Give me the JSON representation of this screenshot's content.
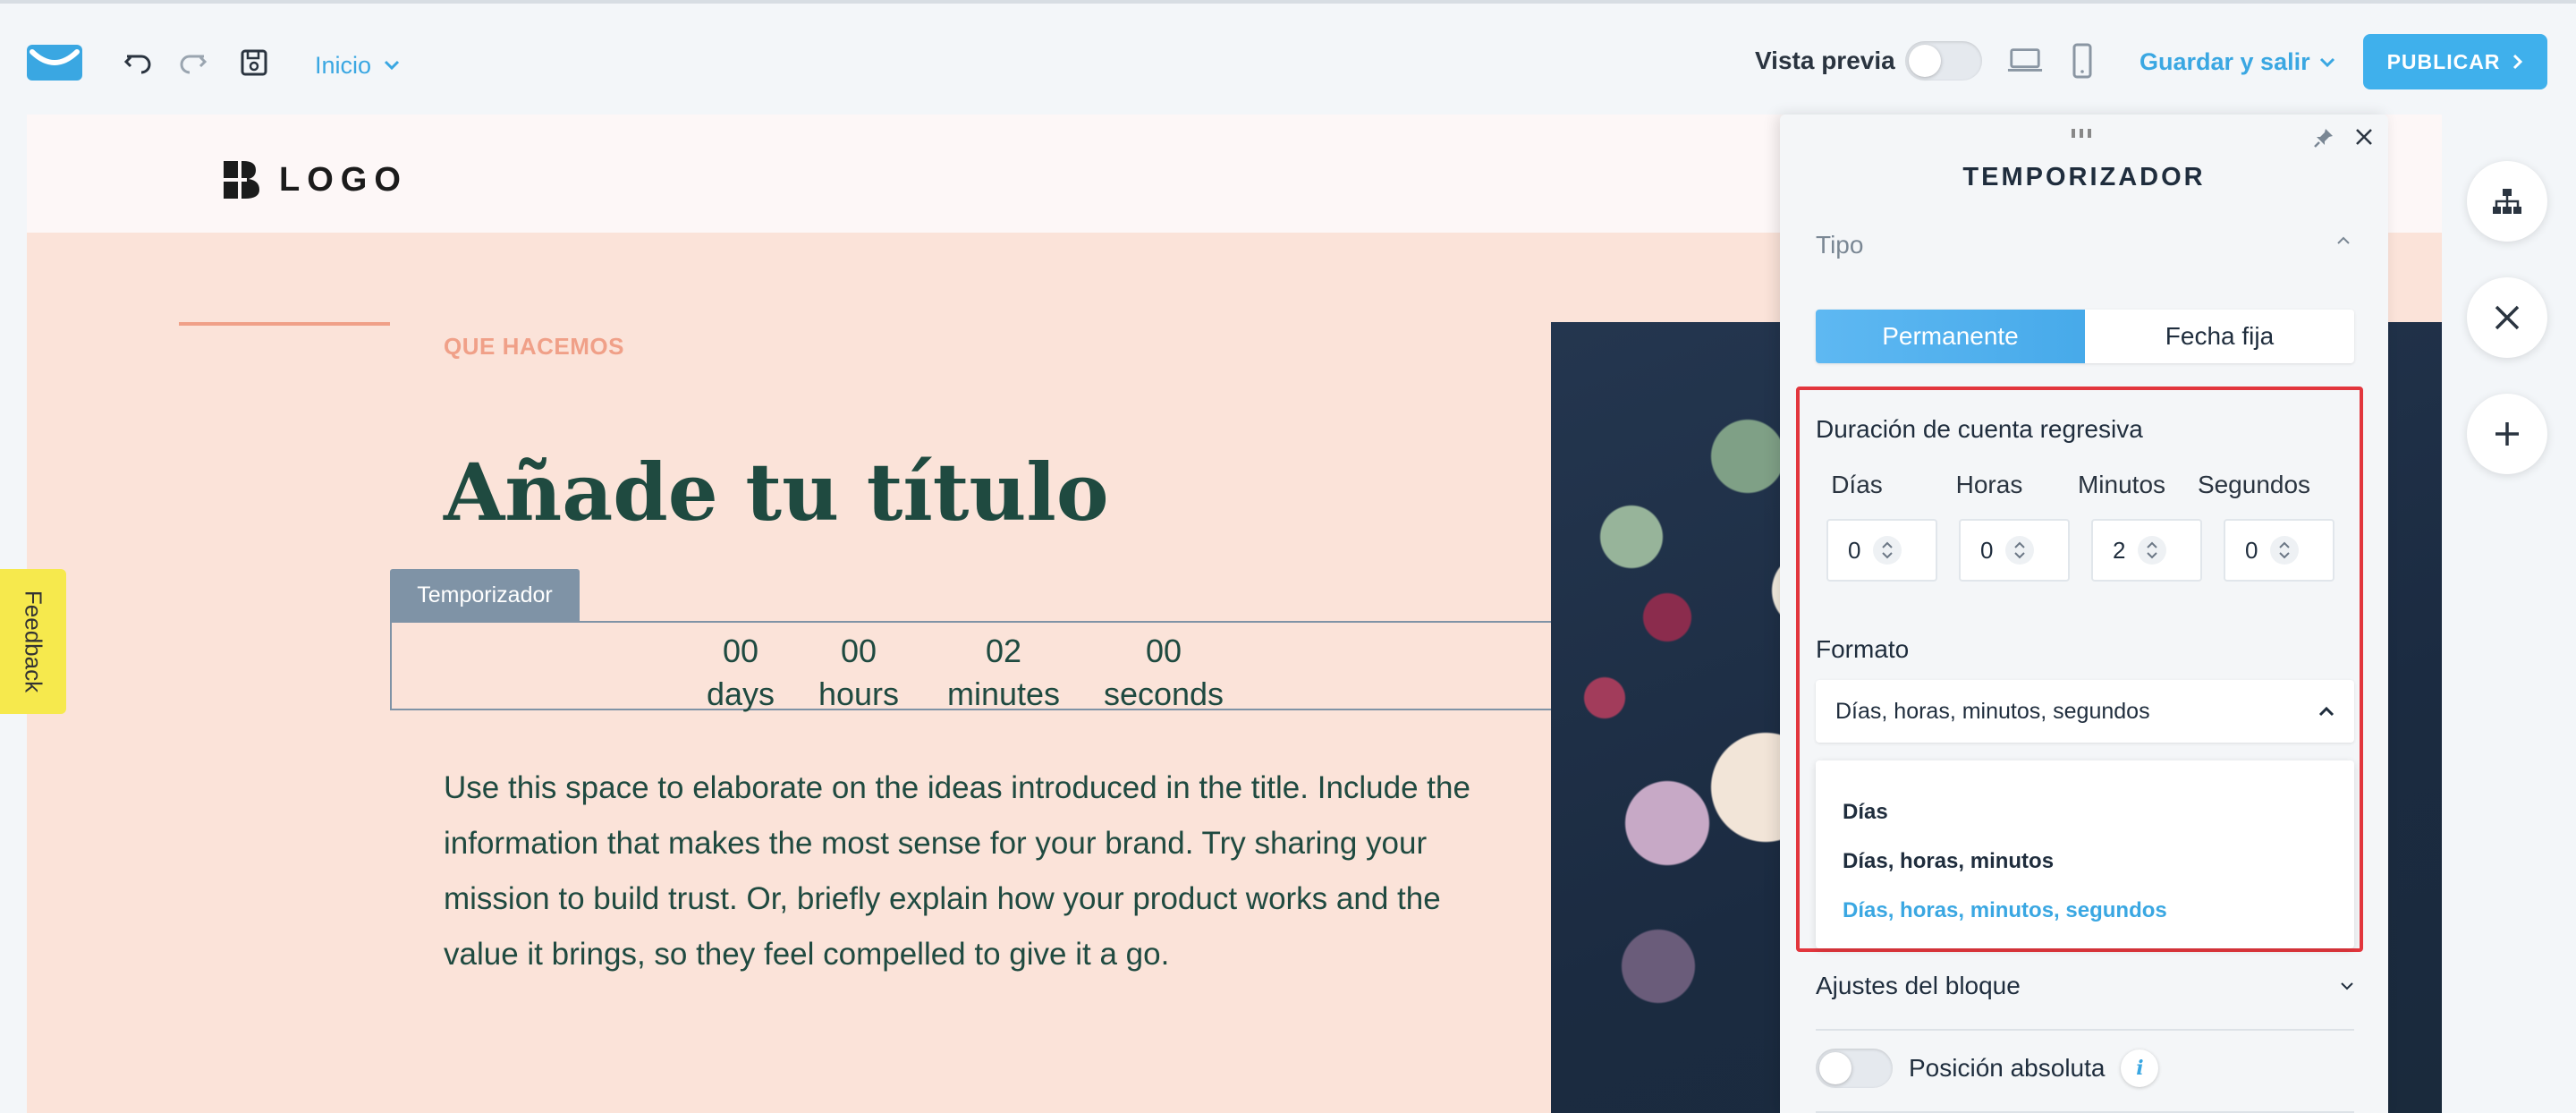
{
  "toolbar": {
    "page_selector": "Inicio",
    "preview_label": "Vista previa",
    "preview_enabled": false,
    "save_exit_label": "Guardar y salir",
    "publish_label": "PUBLICAR"
  },
  "site": {
    "logo_text": "LOGO",
    "eyebrow": "QUE HACEMOS",
    "headline": "Añade tu título",
    "timer_tag": "Temporizador",
    "timer": [
      {
        "value": "00",
        "unit": "days"
      },
      {
        "value": "00",
        "unit": "hours"
      },
      {
        "value": "02",
        "unit": "minutes"
      },
      {
        "value": "00",
        "unit": "seconds"
      }
    ],
    "body": "Use this space to elaborate on the ideas introduced in the title. Include the information that makes the most sense for your brand. Try sharing your mission to build trust. Or, briefly explain how your product works and the value it brings, so they feel compelled to give it a go."
  },
  "feedback_label": "Feedback",
  "panel": {
    "title": "TEMPORIZADOR",
    "type_section": "Tipo",
    "type_options": [
      "Permanente",
      "Fecha fija"
    ],
    "type_selected": "Permanente",
    "duration_title": "Duración de cuenta regresiva",
    "duration": [
      {
        "label": "Días",
        "value": "0"
      },
      {
        "label": "Horas",
        "value": "0"
      },
      {
        "label": "Minutos",
        "value": "2"
      },
      {
        "label": "Segundos",
        "value": "0"
      }
    ],
    "format_title": "Formato",
    "format_selected": "Días, horas, minutos, segundos",
    "format_options": [
      "Días",
      "Días, horas, minutos",
      "Días, horas, minutos, segundos"
    ],
    "block_settings": "Ajustes del bloque",
    "absolute_position": "Posición absoluta",
    "absolute_enabled": false
  },
  "colors": {
    "accent": "#3aa7e2",
    "canvas_bg": "#fbe3d9",
    "headline": "#1f4a40",
    "highlight_border": "#e2363d"
  }
}
